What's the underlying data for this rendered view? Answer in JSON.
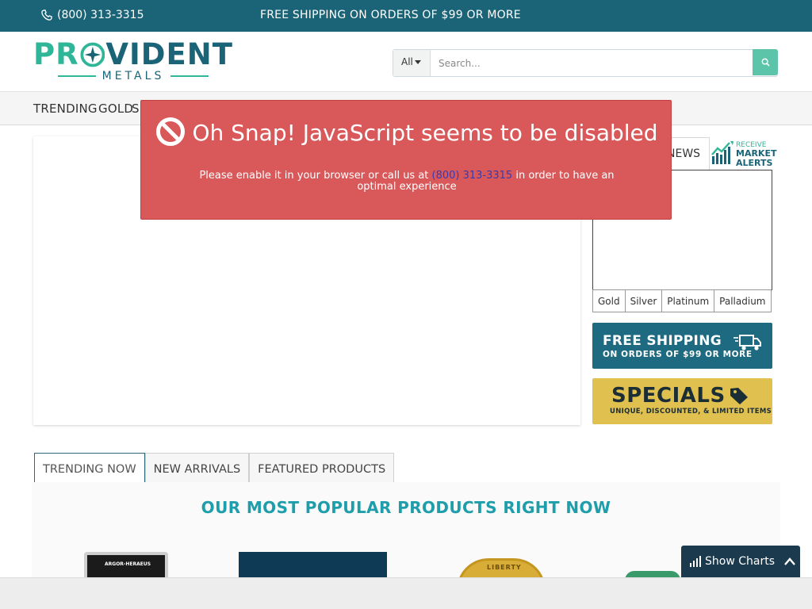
{
  "topbar": {
    "phone": "(800) 313-3315",
    "promo": "FREE SHIPPING ON ORDERS OF $99 OR MORE"
  },
  "logo": {
    "word_left": "PR",
    "word_right": "VIDENT",
    "sub": "METALS"
  },
  "search": {
    "category": "All",
    "placeholder": "Search..."
  },
  "nav": {
    "items": [
      "TRENDING",
      "GOLD",
      "S"
    ]
  },
  "alert": {
    "title": "Oh Snap! JavaScript seems to be disabled",
    "body_before": "Please enable it in your browser or call us at ",
    "phone": "(800) 313-3315",
    "body_after": " in order to have an optimal experience"
  },
  "side": {
    "news_tab": "NEWS",
    "alerts_line1": "RECEIVE",
    "alerts_line2": "MARKET",
    "alerts_line3": "ALERTS",
    "metal_tabs": [
      "Gold",
      "Silver",
      "Platinum",
      "Palladium"
    ],
    "shipping_l1": "FREE SHIPPING",
    "shipping_l2": "ON ORDERS OF $99 OR MORE",
    "specials_l1": "SPECIALS",
    "specials_l2": "UNIQUE, DISCOUNTED, & LIMITED ITEMS"
  },
  "products": {
    "tabs": [
      "TRENDING NOW",
      "NEW ARRIVALS",
      "FEATURED PRODUCTS"
    ],
    "heading": "OUR MOST POPULAR PRODUCTS RIGHT NOW",
    "p1_label": "ARGOR-HERAEUS",
    "p3_label": "LIBERTY"
  },
  "charts_toggle": "Show Charts",
  "colors": {
    "brand_dark": "#1b6477",
    "brand_green": "#2fb597",
    "alert_red": "#d9585a",
    "heading_teal": "#1e9eaa",
    "specials_gold": "#e0c14f"
  }
}
